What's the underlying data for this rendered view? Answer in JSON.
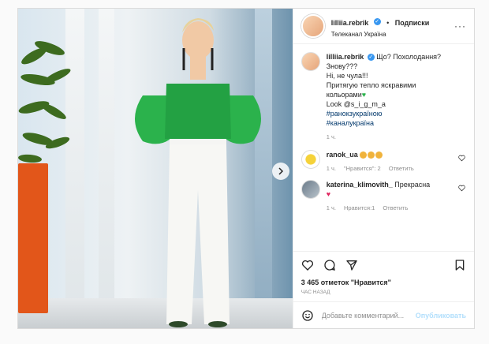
{
  "header": {
    "username": "lilliia.rebrik",
    "follow_label": "Подписки",
    "location": "Телеканал Україна"
  },
  "caption": {
    "username": "lilliia.rebrik",
    "lines": [
      "Що? Похолодання?",
      "Знову???",
      "Ні, не чула!!!",
      "Притягую тепло яскравими",
      "кольорами",
      "Look @s_i_g_m_a"
    ],
    "hashtags": [
      "#ранокзукраїною",
      "#каналукраїна"
    ],
    "time": "1 ч."
  },
  "comments": [
    {
      "username": "ranok_ua",
      "text": "",
      "time": "1 ч.",
      "likes_label": "\"Нравится\": 2",
      "reply_label": "Ответить"
    },
    {
      "username": "katerina_klimovith_",
      "text": "Прекрасна",
      "time": "1 ч.",
      "likes_label": "Нравится:1",
      "reply_label": "Ответить"
    }
  ],
  "stats": {
    "likes": "3 465 отметок \"Нравится\"",
    "posted": "час назад"
  },
  "composer": {
    "placeholder": "Добавьте комментарий...",
    "post_label": "Опубликовать"
  },
  "colors": {
    "accent": "#3897f0",
    "link": "#00376b",
    "muted": "#8e8e8e",
    "top_green": "#2bb24c",
    "pot_orange": "#e2561a"
  }
}
